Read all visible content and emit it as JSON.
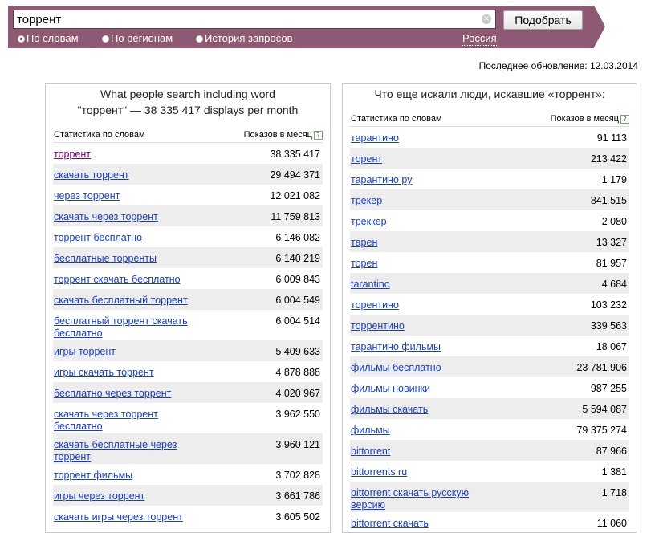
{
  "search": {
    "query": "торрент",
    "button_label": "Подобрать",
    "clear_glyph": "×"
  },
  "modes": [
    {
      "label": "По словам",
      "selected": true
    },
    {
      "label": "По регионам",
      "selected": false
    },
    {
      "label": "История запросов",
      "selected": false
    }
  ],
  "region": "Россия",
  "updated": "Последнее обновление: 12.03.2014",
  "left": {
    "title_line1": "What people search including word",
    "title_line2": "\"торрент\" — 38 335 417 displays per month",
    "col_word": "Статистика по словам",
    "col_count": "Показов в месяц",
    "help": "?",
    "rows": [
      {
        "word": "торрент",
        "count": "38 335 417"
      },
      {
        "word": "скачать торрент",
        "count": "29 494 371"
      },
      {
        "word": "через торрент",
        "count": "12 021 082"
      },
      {
        "word": "скачать через торрент",
        "count": "11 759 813"
      },
      {
        "word": "торрент бесплатно",
        "count": "6 146 082"
      },
      {
        "word": "бесплатные торренты",
        "count": "6 140 219"
      },
      {
        "word": "торрент скачать бесплатно",
        "count": "6 009 843"
      },
      {
        "word": "скачать бесплатный торрент",
        "count": "6 004 549"
      },
      {
        "word": "бесплатный торрент скачать бесплатно",
        "count": "6 004 514"
      },
      {
        "word": "игры торрент",
        "count": "5 409 633"
      },
      {
        "word": "игры скачать торрент",
        "count": "4 878 888"
      },
      {
        "word": "бесплатно через торрент",
        "count": "4 020 967"
      },
      {
        "word": "скачать через торрент бесплатно",
        "count": "3 962 550"
      },
      {
        "word": "скачать бесплатные через торрент",
        "count": "3 960 121"
      },
      {
        "word": "торрент фильмы",
        "count": "3 702 828"
      },
      {
        "word": "игры через торрент",
        "count": "3 661 786"
      },
      {
        "word": "скачать игры через торрент",
        "count": "3 605 502"
      }
    ]
  },
  "right": {
    "title": "Что еще искали люди, искавшие «торрент»:",
    "col_word": "Статистика по словам",
    "col_count": "Показов в месяц",
    "help": "?",
    "rows": [
      {
        "word": "тарантино",
        "count": "91 113"
      },
      {
        "word": "торент",
        "count": "213 422"
      },
      {
        "word": "тарантино ру",
        "count": "1 179"
      },
      {
        "word": "трекер",
        "count": "841 515"
      },
      {
        "word": "треккер",
        "count": "2 080"
      },
      {
        "word": "тарен",
        "count": "13 327"
      },
      {
        "word": "торен",
        "count": "81 957"
      },
      {
        "word": "tarantino",
        "count": "4 684"
      },
      {
        "word": "торентино",
        "count": "103 232"
      },
      {
        "word": "торрентино",
        "count": "339 563"
      },
      {
        "word": "тарантино фильмы",
        "count": "18 067"
      },
      {
        "word": "фильмы бесплатно",
        "count": "23 781 906"
      },
      {
        "word": "фильмы новинки",
        "count": "987 255"
      },
      {
        "word": "фильмы скачать",
        "count": "5 594 087"
      },
      {
        "word": "фильмы",
        "count": "79 375 274"
      },
      {
        "word": "bittorrent",
        "count": "87 966"
      },
      {
        "word": "bittorrents ru",
        "count": "1 381"
      },
      {
        "word": "bittorrent скачать русскую версию",
        "count": "1 718"
      },
      {
        "word": "bittorrent скачать",
        "count": "11 060"
      }
    ]
  },
  "colors": {
    "header_bg": "#8e5a73",
    "link": "#1a3dc1",
    "visited_link": "#800080",
    "row_alt": "#ededed"
  }
}
